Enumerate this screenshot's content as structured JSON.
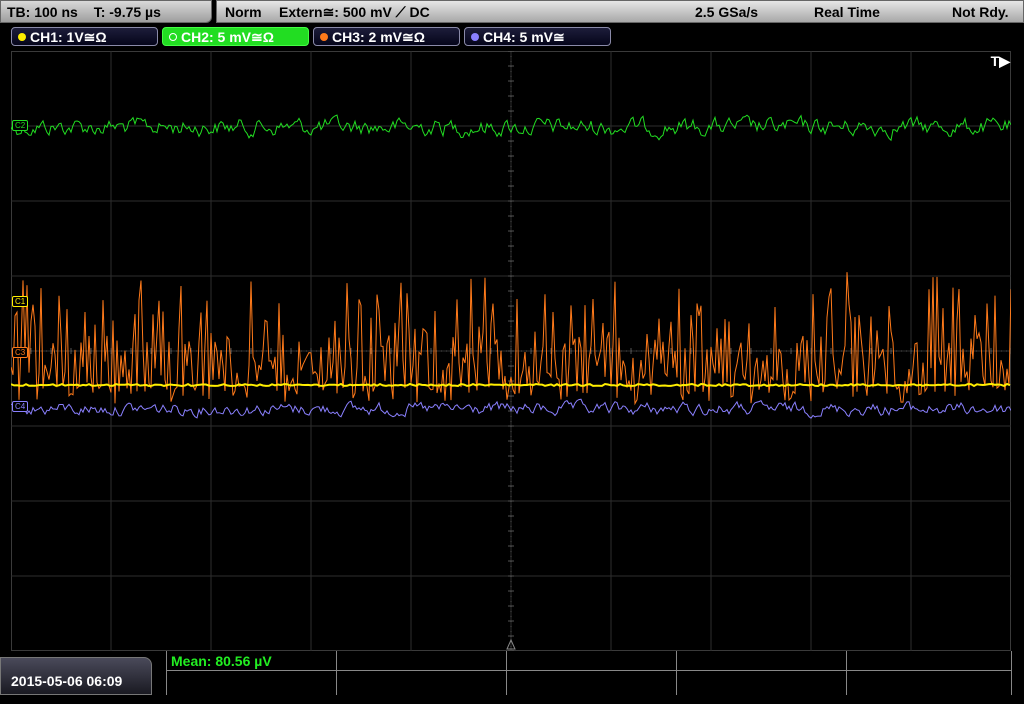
{
  "topbar": {
    "timebase": "TB: 100 ns",
    "trigger_time": "T: -9.75 µs",
    "mode": "Norm",
    "trigger_source": "Extern≅: 500 mV ⟋ DC",
    "sample_rate": "2.5 GSa/s",
    "acq_mode": "Real Time",
    "status": "Not Rdy."
  },
  "channels": [
    {
      "label": "CH1: 1V≅Ω",
      "color": "#ffee00",
      "marker": "C1"
    },
    {
      "label": "CH2: 5 mV≅Ω",
      "color": "#22dd22",
      "marker": "C2"
    },
    {
      "label": "CH3: 2 mV≅Ω",
      "color": "#ff7a1a",
      "marker": "C3"
    },
    {
      "label": "CH4: 5 mV≅",
      "color": "#8a80ff",
      "marker": "C4"
    }
  ],
  "trigger_marker": "T▶",
  "measurement": {
    "mean": "Mean: 80.56 µV"
  },
  "datetime": "2015-05-06 06:09",
  "colors": {
    "grid": "#2e2e2e",
    "grid_center": "#555555"
  }
}
